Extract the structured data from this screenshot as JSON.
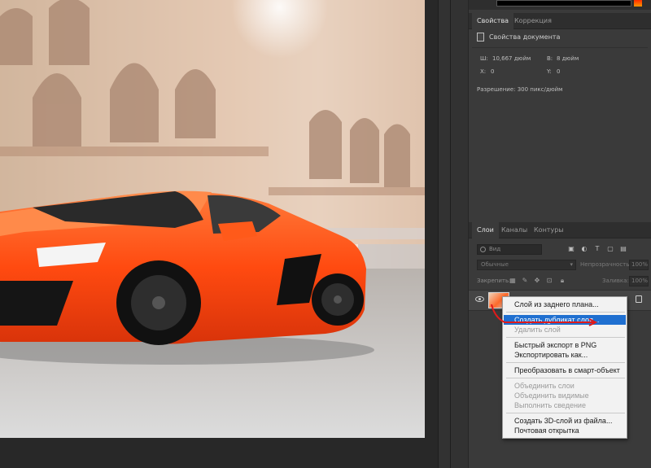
{
  "properties_panel": {
    "tabs": [
      "Свойства",
      "Коррекция"
    ],
    "header": "Свойства документа",
    "width_label": "Ш:",
    "width_value": "10,667 дюйм",
    "height_label": "В:",
    "height_value": "8 дюйм",
    "x_label": "X:",
    "x_value": "0",
    "y_label": "Y:",
    "y_value": "0",
    "resolution": "Разрешение: 300 пикс/дюйм"
  },
  "layers_panel": {
    "tabs": [
      "Слои",
      "Каналы",
      "Контуры"
    ],
    "search_placeholder": "Вид",
    "blend_mode": "Обычные",
    "opacity_label": "Непрозрачность:",
    "opacity_value": "100%",
    "lock_label": "Закрепить:",
    "fill_label": "Заливка:",
    "fill_value": "100%"
  },
  "context_menu": {
    "groups": [
      [
        {
          "label": "Слой из заднего плана...",
          "enabled": true,
          "highlighted": false
        }
      ],
      [
        {
          "label": "Создать дубликат слоя...",
          "enabled": true,
          "highlighted": true
        },
        {
          "label": "Удалить слой",
          "enabled": false,
          "highlighted": false
        }
      ],
      [
        {
          "label": "Быстрый экспорт в PNG",
          "enabled": true,
          "highlighted": false
        },
        {
          "label": "Экспортировать как...",
          "enabled": true,
          "highlighted": false
        }
      ],
      [
        {
          "label": "Преобразовать в смарт-объект",
          "enabled": true,
          "highlighted": false
        }
      ],
      [
        {
          "label": "Объединить слои",
          "enabled": false,
          "highlighted": false
        },
        {
          "label": "Объединить видимые",
          "enabled": false,
          "highlighted": false
        },
        {
          "label": "Выполнить сведение",
          "enabled": false,
          "highlighted": false
        }
      ],
      [
        {
          "label": "Создать 3D-слой из файла...",
          "enabled": true,
          "highlighted": false
        },
        {
          "label": "Почтовая открытка",
          "enabled": true,
          "highlighted": false
        }
      ]
    ]
  },
  "colors": {
    "panel_bg": "#3a3a3a",
    "menu_highlight": "#1f6fd0",
    "car_orange": "#ff4a10",
    "annotation_red": "#e01a1a"
  }
}
